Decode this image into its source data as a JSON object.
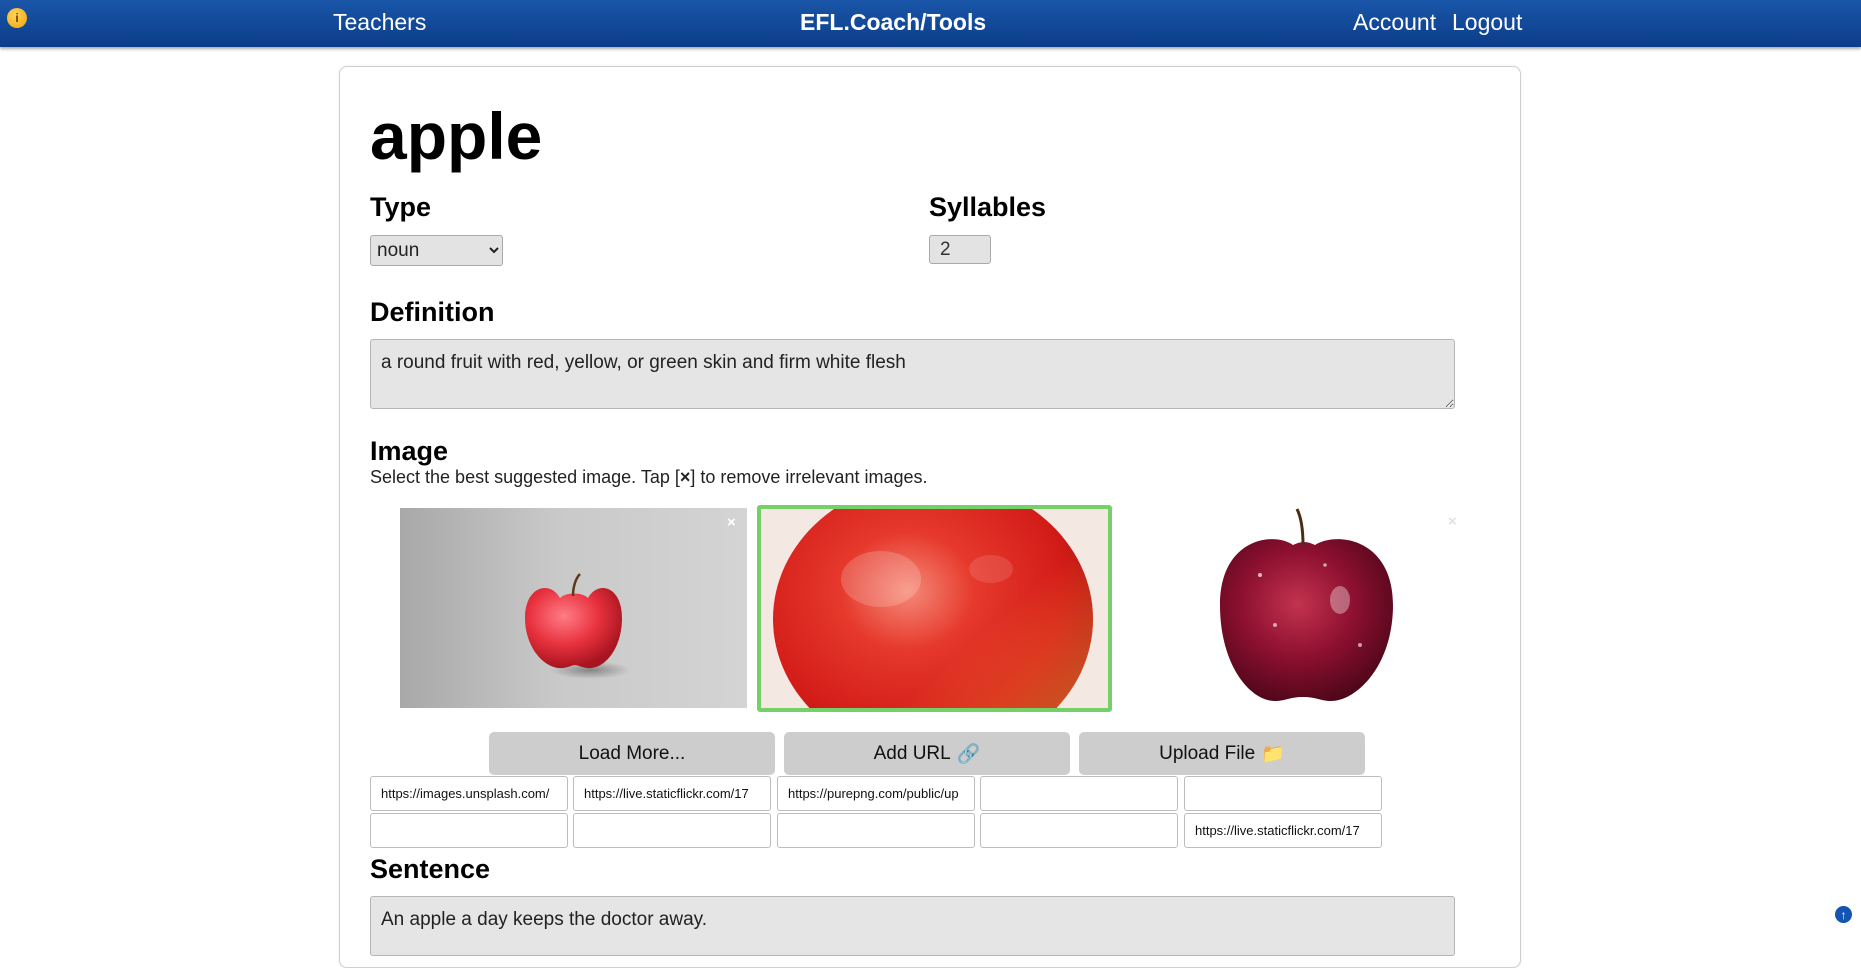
{
  "nav": {
    "teachers": "Teachers",
    "brand": "EFL.Coach/Tools",
    "account": "Account",
    "logout": "Logout"
  },
  "word": {
    "title": "apple",
    "type_label": "Type",
    "type_value": "noun",
    "syllables_label": "Syllables",
    "syllables_value": "2",
    "definition_label": "Definition",
    "definition_value": "a round fruit with red, yellow, or green skin and firm white flesh",
    "image_label": "Image",
    "image_hint_before": "Select the best suggested image. Tap [",
    "image_hint_x": "×",
    "image_hint_after": "] to remove irrelevant images.",
    "sentence_label": "Sentence",
    "sentence_value": "An apple a day keeps the doctor away."
  },
  "images": {
    "remove_symbol": "×",
    "selected_index": 1
  },
  "buttons": {
    "load_more": "Load More...",
    "add_url": "Add URL",
    "add_url_icon": "🔗",
    "upload_file": "Upload File",
    "upload_file_icon": "📁"
  },
  "urls": {
    "row1": [
      "https://images.unsplash.com/",
      "https://live.staticflickr.com/17",
      "https://purepng.com/public/up",
      "",
      ""
    ],
    "row2": [
      "",
      "",
      "",
      "",
      "https://live.staticflickr.com/17"
    ]
  },
  "colors": {
    "topbar": "#0b3d8a",
    "selected_border": "#74d168"
  }
}
